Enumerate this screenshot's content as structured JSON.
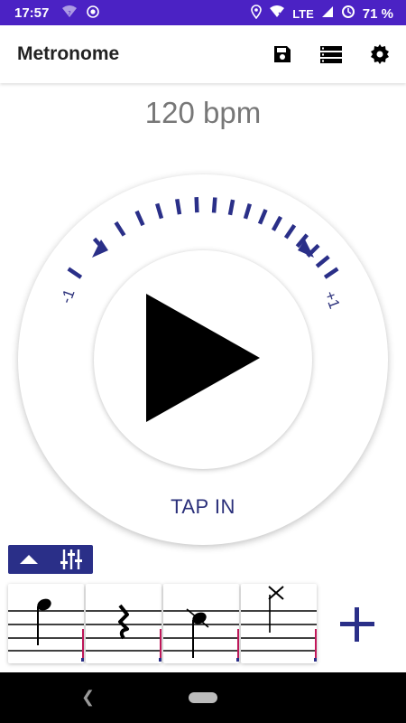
{
  "status_bar": {
    "time": "17:57",
    "network": "LTE",
    "battery": "71 %"
  },
  "app_bar": {
    "title": "Metronome",
    "actions": [
      "save-icon",
      "list-icon",
      "settings-icon"
    ]
  },
  "tempo": {
    "bpm_text": "120 bpm",
    "minus_label": "-1",
    "plus_label": "+1",
    "tap_in_label": "TAP IN",
    "accent_color": "#2A2F88"
  },
  "play_button": {
    "icon": "play-icon"
  },
  "pattern": {
    "toggle_icons": [
      "collapse-up-icon",
      "sliders-icon"
    ],
    "measures": [
      {
        "note": "quarter-note"
      },
      {
        "note": "quarter-rest"
      },
      {
        "note": "accented-note"
      },
      {
        "note": "muted-x-note"
      }
    ],
    "add_icon": "plus-icon"
  },
  "nav_bar": {
    "back_icon": "back-icon",
    "home_icon": "home-pill-icon"
  }
}
